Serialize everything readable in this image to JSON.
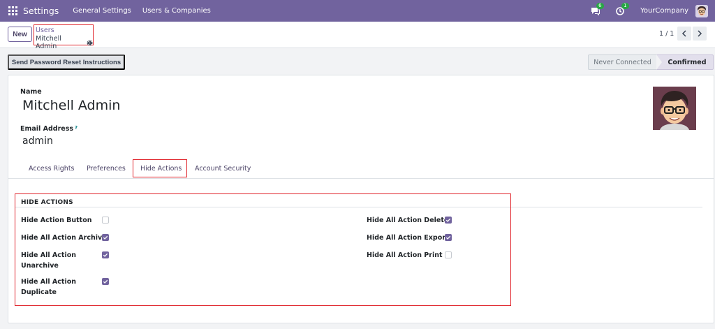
{
  "navbar": {
    "brand": "Settings",
    "menus": [
      "General Settings",
      "Users & Companies"
    ],
    "messages_badge": "6",
    "activities_badge": "1",
    "company": "YourCompany"
  },
  "control": {
    "new_label": "New",
    "breadcrumb_parent": "Users",
    "breadcrumb_current": "Mitchell Admin",
    "pager": "1 / 1"
  },
  "actions": {
    "reset_password_label": "Send Password Reset Instructions"
  },
  "statusbar": {
    "stages": [
      "Never Connected",
      "Confirmed"
    ],
    "active": "Confirmed"
  },
  "form": {
    "name_label": "Name",
    "name_value": "Mitchell Admin",
    "email_label": "Email Address",
    "email_help": "?",
    "email_value": "admin"
  },
  "tabs": [
    "Access Rights",
    "Preferences",
    "Hide Actions",
    "Account Security"
  ],
  "active_tab": "Hide Actions",
  "hide_actions": {
    "title": "HIDE ACTIONS",
    "left": [
      {
        "label": "Hide Action Button",
        "checked": false
      },
      {
        "label": "Hide All Action Archive",
        "checked": true
      },
      {
        "label_line1": "Hide All Action",
        "label_line2": "Unarchive",
        "checked": true
      },
      {
        "label_line1": "Hide All Action",
        "label_line2": "Duplicate",
        "checked": true
      }
    ],
    "right": [
      {
        "label": "Hide All Action Delete",
        "checked": true
      },
      {
        "label": "Hide All Action Export",
        "checked": true
      },
      {
        "label": "Hide All Action Print",
        "checked": false
      }
    ]
  },
  "colors": {
    "brand": "#71639e",
    "highlight": "#e0252c",
    "badge": "#28a745"
  }
}
